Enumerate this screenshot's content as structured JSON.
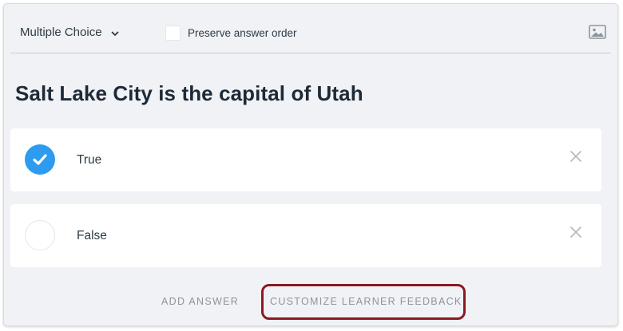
{
  "toolbar": {
    "question_type": "Multiple Choice",
    "preserve_order_label": "Preserve answer order",
    "preserve_order_checked": false,
    "image_icon": "image-icon"
  },
  "question": {
    "text": "Salt Lake City is the capital of Utah"
  },
  "answers": [
    {
      "label": "True",
      "correct": true
    },
    {
      "label": "False",
      "correct": false
    }
  ],
  "footer": {
    "add_answer": "ADD ANSWER",
    "customize_feedback": "CUSTOMIZE LEARNER FEEDBACK"
  },
  "colors": {
    "accent": "#2d9bf0",
    "highlight": "#8b1a22",
    "panel_bg": "#f1f2f6"
  }
}
